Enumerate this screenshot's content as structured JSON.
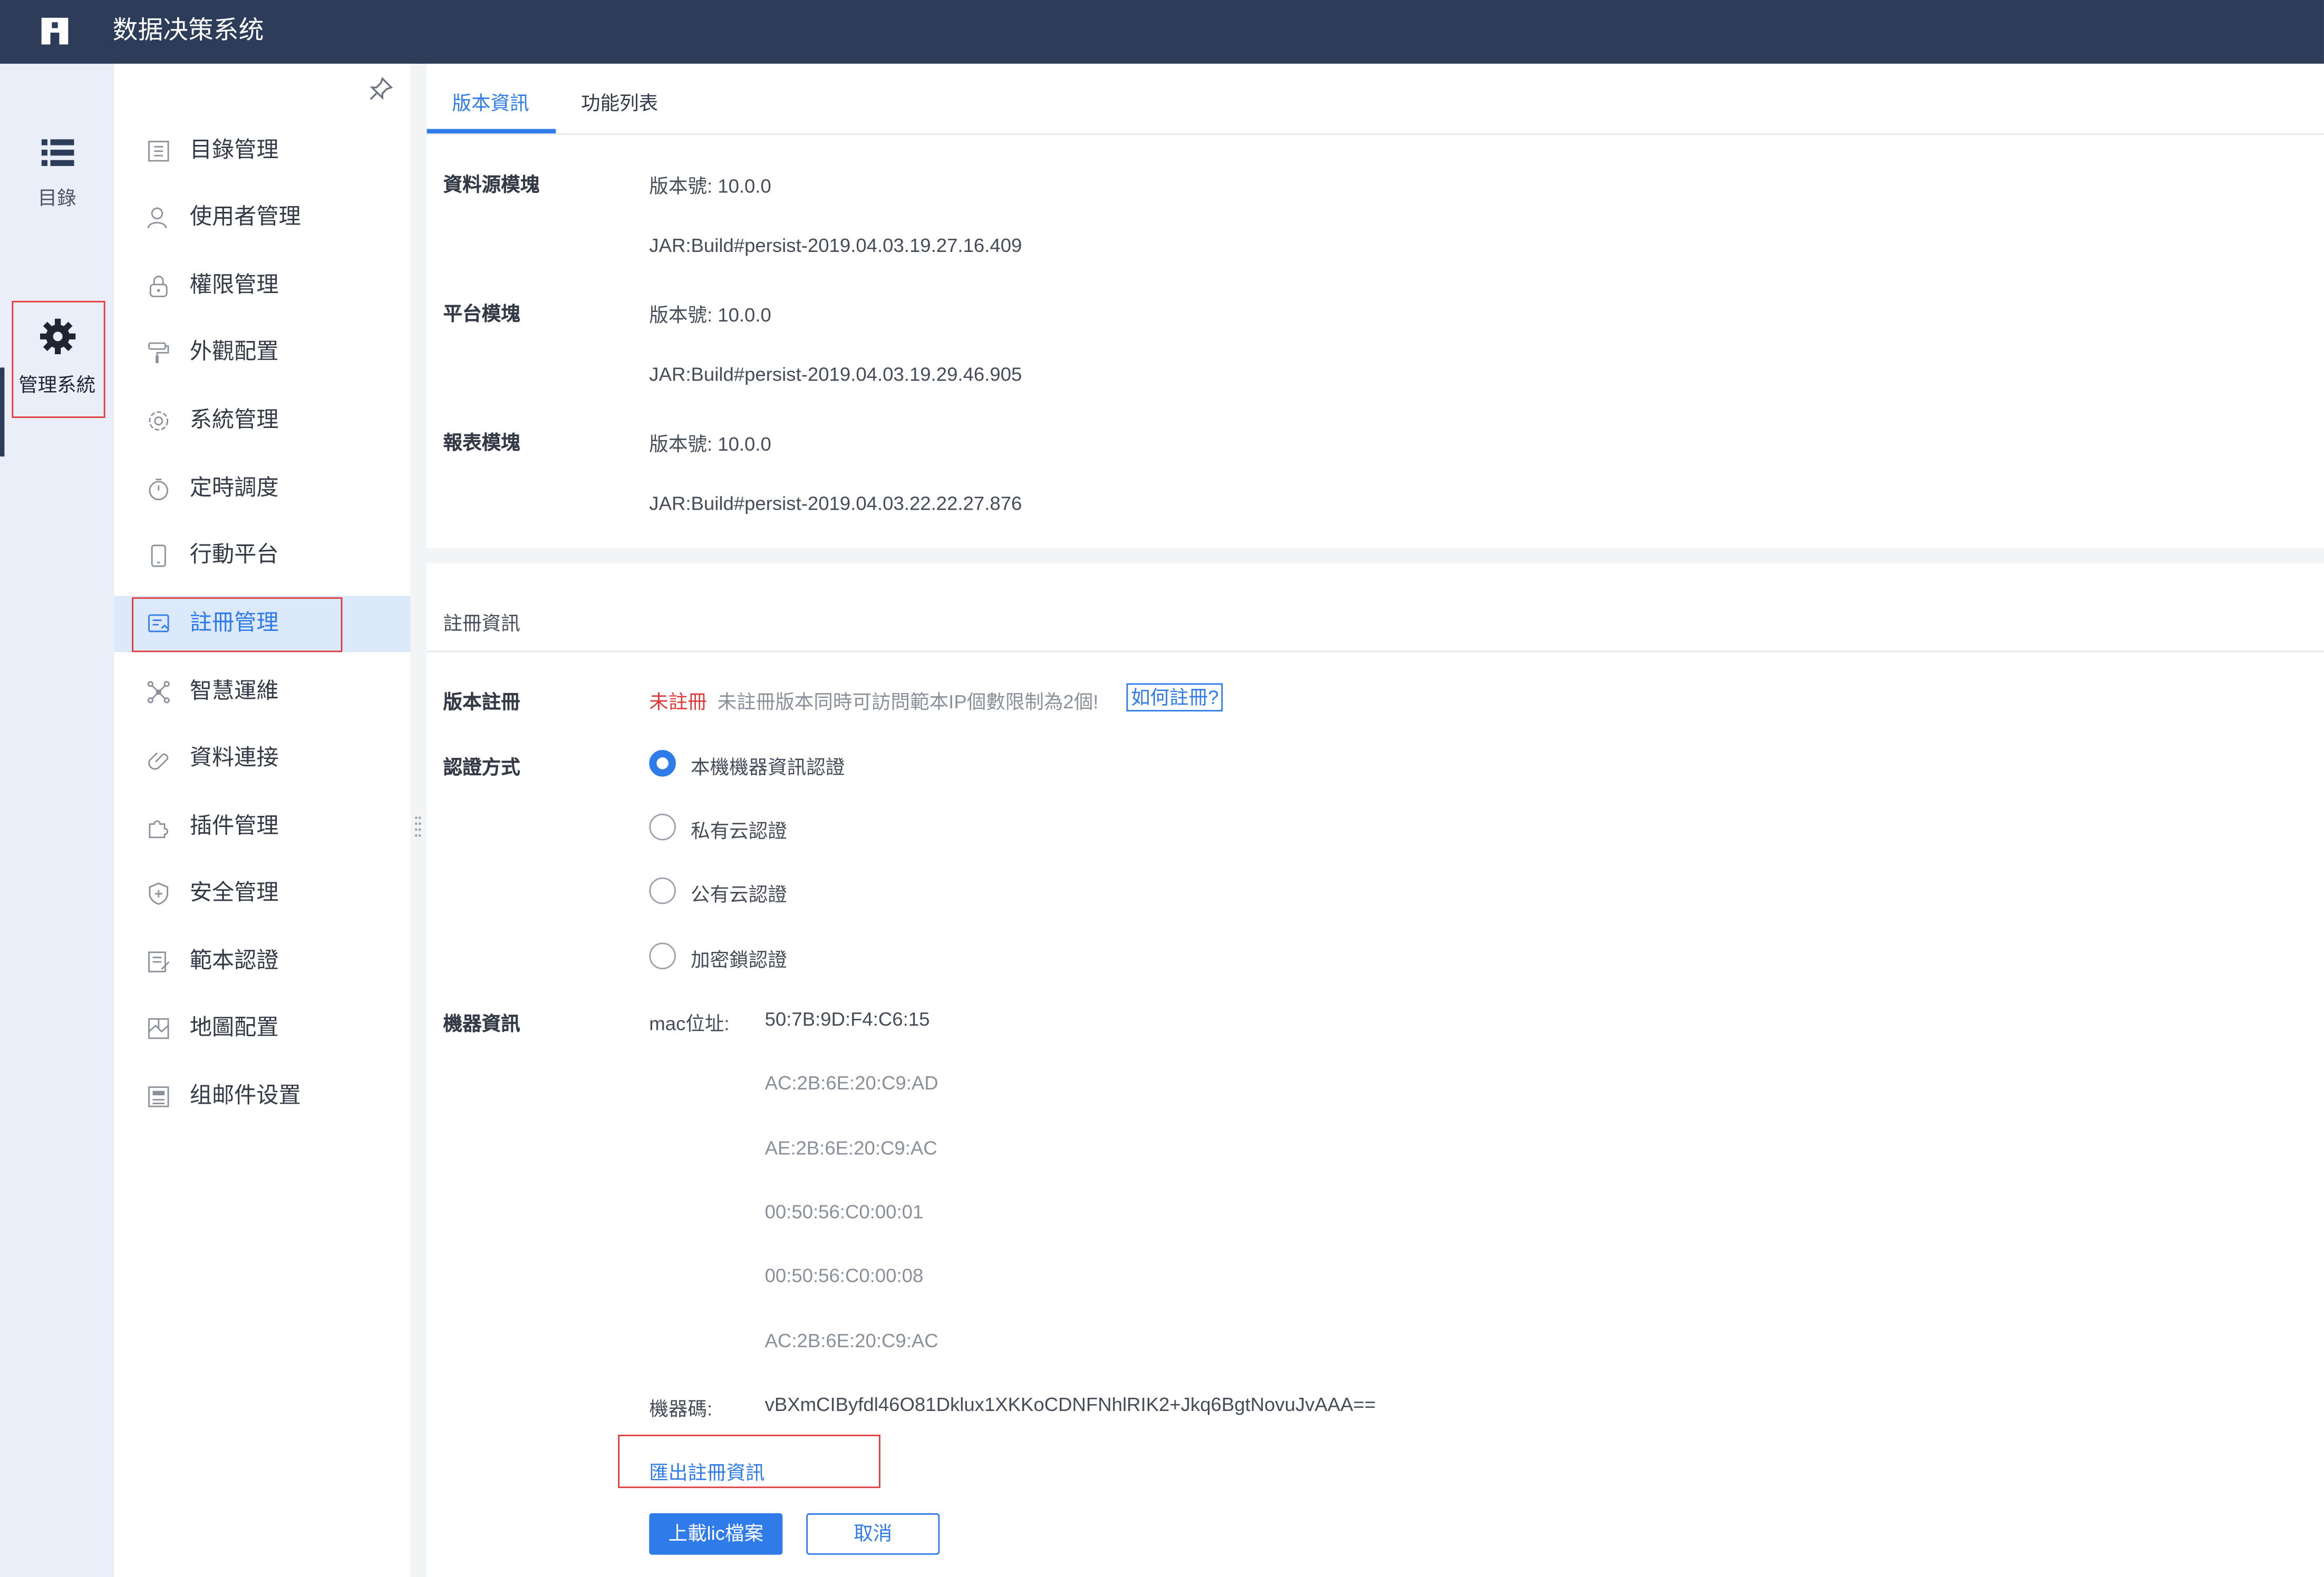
{
  "app": {
    "title": "数据决策系统"
  },
  "rail": [
    {
      "label": "目錄",
      "icon": "list-icon"
    },
    {
      "label": "管理系統",
      "icon": "gear-icon"
    }
  ],
  "sidebar": {
    "items": [
      {
        "label": "目錄管理",
        "icon": "catalog-icon"
      },
      {
        "label": "使用者管理",
        "icon": "user-icon"
      },
      {
        "label": "權限管理",
        "icon": "lock-icon"
      },
      {
        "label": "外觀配置",
        "icon": "paint-roller-icon"
      },
      {
        "label": "系統管理",
        "icon": "settings-icon"
      },
      {
        "label": "定時調度",
        "icon": "timer-icon"
      },
      {
        "label": "行動平台",
        "icon": "mobile-icon"
      },
      {
        "label": "註冊管理",
        "icon": "register-icon",
        "active": true
      },
      {
        "label": "智慧運維",
        "icon": "network-icon"
      },
      {
        "label": "資料連接",
        "icon": "link-icon"
      },
      {
        "label": "插件管理",
        "icon": "plugin-icon"
      },
      {
        "label": "安全管理",
        "icon": "shield-icon"
      },
      {
        "label": "範本認證",
        "icon": "template-icon"
      },
      {
        "label": "地圖配置",
        "icon": "map-icon"
      },
      {
        "label": "组邮件设置",
        "icon": "mail-group-icon"
      }
    ]
  },
  "tabs": [
    {
      "label": "版本資訊",
      "active": true
    },
    {
      "label": "功能列表",
      "active": false
    }
  ],
  "modules": [
    {
      "label": "資料源模塊",
      "version": "版本號: 10.0.0",
      "jar": "JAR:Build#persist-2019.04.03.19.27.16.409"
    },
    {
      "label": "平台模塊",
      "version": "版本號: 10.0.0",
      "jar": "JAR:Build#persist-2019.04.03.19.29.46.905"
    },
    {
      "label": "報表模塊",
      "version": "版本號: 10.0.0",
      "jar": "JAR:Build#persist-2019.04.03.22.22.27.876"
    }
  ],
  "registration": {
    "section_title": "註冊資訊",
    "version_reg_label": "版本註冊",
    "status": "未註冊",
    "note": "未註冊版本同時可訪問範本IP個數限制為2個!",
    "how_to": "如何註冊?",
    "auth_label": "認證方式",
    "auth_options": [
      {
        "label": "本機機器資訊認證",
        "checked": true
      },
      {
        "label": "私有云認證",
        "checked": false
      },
      {
        "label": "公有云認證",
        "checked": false
      },
      {
        "label": "加密鎖認證",
        "checked": false
      }
    ],
    "machine_label": "機器資訊",
    "mac_key": "mac位址:",
    "macs": [
      "50:7B:9D:F4:C6:15",
      "AC:2B:6E:20:C9:AD",
      "AE:2B:6E:20:C9:AC",
      "00:50:56:C0:00:01",
      "00:50:56:C0:00:08",
      "AC:2B:6E:20:C9:AC"
    ],
    "code_key": "機器碼:",
    "machine_code": "vBXmCIByfdl46O81Dklux1XKKoCDNFNhlRIK2+Jkq6BgtNovuJvAAA==",
    "export_link": "匯出註冊資訊",
    "upload_button": "上載lic檔案",
    "cancel_button": "取消"
  },
  "colors": {
    "header": "#2c3c59",
    "accent": "#2f7bea",
    "danger": "#e0393a"
  }
}
